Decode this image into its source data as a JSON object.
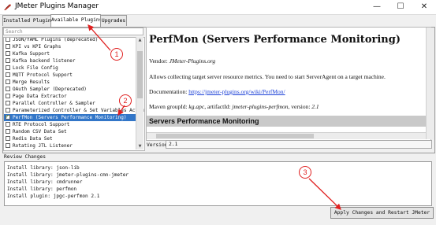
{
  "window": {
    "title": "JMeter Plugins Manager",
    "controls": {
      "minimize": "—",
      "maximize": "☐",
      "close": "✕"
    }
  },
  "tabs": [
    {
      "label": "Installed Plugins",
      "active": false
    },
    {
      "label": "Available Plugins",
      "active": true
    },
    {
      "label": "Upgrades",
      "active": false
    }
  ],
  "search": {
    "placeholder": "Search"
  },
  "plugin_list": [
    {
      "label": "JSON/YAML Plugins (deprecated)",
      "checked": false,
      "selected": false
    },
    {
      "label": "KPI vs KPI Graphs",
      "checked": false,
      "selected": false
    },
    {
      "label": "Kafka Support",
      "checked": false,
      "selected": false
    },
    {
      "label": "Kafka backend listener",
      "checked": false,
      "selected": false
    },
    {
      "label": "Lock File Config",
      "checked": false,
      "selected": false
    },
    {
      "label": "MQTT Protocol Support",
      "checked": false,
      "selected": false
    },
    {
      "label": "Merge Results",
      "checked": false,
      "selected": false
    },
    {
      "label": "OAuth Sampler (Deprecated)",
      "checked": false,
      "selected": false
    },
    {
      "label": "Page Data Extractor",
      "checked": false,
      "selected": false
    },
    {
      "label": "Parallel Controller & Sampler",
      "checked": false,
      "selected": false
    },
    {
      "label": "Parameterized Controller & Set Variables Action",
      "checked": false,
      "selected": false
    },
    {
      "label": "PerfMon (Servers Performance Monitoring)",
      "checked": true,
      "selected": true
    },
    {
      "label": "RTE Protocol Support",
      "checked": false,
      "selected": false
    },
    {
      "label": "Random CSV Data Set",
      "checked": false,
      "selected": false
    },
    {
      "label": "Redis Data Set",
      "checked": false,
      "selected": false
    },
    {
      "label": "Rotating JTL Listener",
      "checked": false,
      "selected": false
    }
  ],
  "details": {
    "title": "PerfMon (Servers Performance Monitoring)",
    "vendor_prefix": "Vendor: ",
    "vendor": "JMeter-Plugins.org",
    "description": "Allows collecting target server resource metrics. You need to start ServerAgent on a target machine.",
    "documentation_prefix": "Documentation: ",
    "documentation_link": "https://jmeter-plugins.org/wiki/PerfMon/",
    "maven_prefix": "Maven groupId: ",
    "maven_group": "kg.apc",
    "artifact_prefix": ", artifactId: ",
    "artifact": "jmeter-plugins-perfmon",
    "version_prefix": ", version: ",
    "maven_version": "2.1",
    "section_title": "Servers Performance Monitoring"
  },
  "version": {
    "label": "Version:",
    "value": "2.1"
  },
  "review": {
    "label": "Review Changes",
    "lines": [
      "Install library: json-lib",
      "Install library: jmeter-plugins-cmn-jmeter",
      "Install library: cmdrunner",
      "Install library: perfmon",
      "Install plugin: jpgc-perfmon 2.1"
    ]
  },
  "apply_button": "Apply Changes and Restart JMeter",
  "annotations": {
    "marker_1": "1",
    "marker_2": "2",
    "marker_3": "3",
    "color": "#e02020"
  },
  "accent_color": "#3276c8"
}
